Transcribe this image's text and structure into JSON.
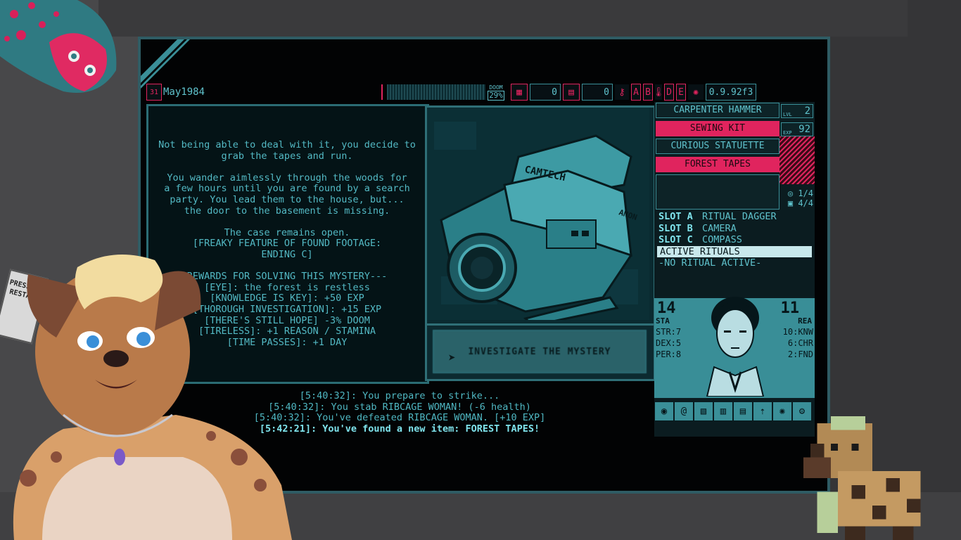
{
  "topbar": {
    "date": "May1984",
    "doom_label": "DOOM",
    "doom_value": "29%",
    "counter1": "0",
    "counter2": "0",
    "letters": [
      "A",
      "B",
      "D",
      "E"
    ],
    "version": "0.9.92f3"
  },
  "story": {
    "paragraphs": "Not being able to deal with it, you decide to\ngrab the tapes and run.\n\nYou wander aimlessly through the woods for\na few hours until you are found by a search\nparty. You lead them to the house, but...\nthe door to the basement is missing.\n\nThe case remains open.\n[FREAKY FEATURE OF FOUND FOOTAGE:\nENDING C]\n\nREWARDS FOR SOLVING THIS MYSTERY---\n[EYE]: the forest is restless\n[KNOWLEDGE IS KEY]: +50 EXP\n[THOROUGH INVESTIGATION]: +15 EXP\n[THERE'S STILL HOPE] -3% DOOM\n[TIRELESS]: +1 REASON / STAMINA\n[TIME PASSES]: +1 DAY"
  },
  "art": {
    "camera_brand": "CAMTECH",
    "side_brand": "ANON"
  },
  "action_button": {
    "label": "INVESTIGATE THE MYSTERY"
  },
  "log": [
    "[5:40:32]: You prepare to strike...",
    "[5:40:32]: You stab RIBCAGE WOMAN! (-6 health)",
    "[5:40:32]: You've defeated RIBCAGE WOMAN. [+10 EXP]",
    "[5:42:21]: You've found a new item: FOREST TAPES!"
  ],
  "inventory": {
    "items": [
      {
        "label": "CARPENTER HAMMER",
        "selected": false
      },
      {
        "label": "SEWING KIT",
        "selected": true
      },
      {
        "label": "CURIOUS STATUETTE",
        "selected": false
      },
      {
        "label": "FOREST TAPES",
        "selected": true
      }
    ],
    "level_label": "LVL",
    "level_value": "2",
    "exp_label": "EXP",
    "exp_value": "92",
    "count1": "1/4",
    "count2": "4/4"
  },
  "slots": {
    "a_label": "SLOT A",
    "a_value": "RITUAL DAGGER",
    "b_label": "SLOT B",
    "b_value": "CAMERA",
    "c_label": "SLOT C",
    "c_value": "COMPASS",
    "rituals_header": "ACTIVE RITUALS",
    "rituals_value": "-NO RITUAL ACTIVE-"
  },
  "stats": {
    "stamina": "14",
    "stamina_label": "STA",
    "reason": "11",
    "reason_label": "REA",
    "str": "STR:7",
    "dex": "DEX:5",
    "per": "PER:8",
    "knw": "10:KNW",
    "chr": "6:CHR",
    "fnd": "2:FND"
  },
  "overlay": {
    "sign_text": "PRESS TO RESTART"
  },
  "colors": {
    "accent": "#e0245e",
    "teal": "#3a8f98",
    "screen_bg": "#020304"
  }
}
